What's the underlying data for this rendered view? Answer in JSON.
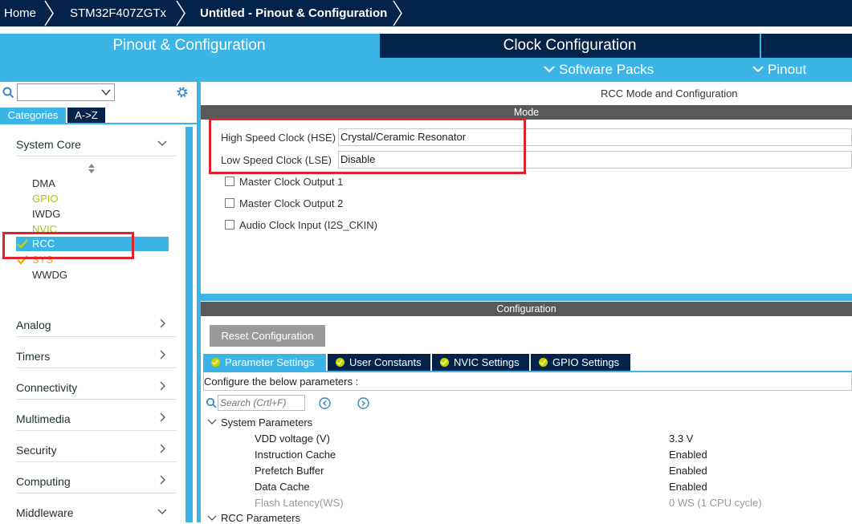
{
  "breadcrumb": {
    "home": "Home",
    "device": "STM32F407ZGTx",
    "project": "Untitled - Pinout & Configuration"
  },
  "main_tabs": {
    "pinout": "Pinout & Configuration",
    "clock": "Clock Configuration"
  },
  "sub_tabs": {
    "software_packs": "Software Packs",
    "pinout": "Pinout"
  },
  "sidebar": {
    "search_value": "",
    "view_tabs": [
      "Categories",
      "A->Z"
    ],
    "categories": {
      "system_core": "System Core",
      "analog": "Analog",
      "timers": "Timers",
      "connectivity": "Connectivity",
      "multimedia": "Multimedia",
      "security": "Security",
      "computing": "Computing",
      "middleware": "Middleware"
    },
    "peripherals": {
      "dma": "DMA",
      "gpio": "GPIO",
      "iwdg": "IWDG",
      "nvic": "NVIC",
      "rcc": "RCC",
      "sys": "SYS",
      "wwdg": "WWDG"
    }
  },
  "panel": {
    "title": "RCC Mode and Configuration",
    "mode_header": "Mode",
    "hse_label": "High Speed Clock (HSE)",
    "hse_value": "Crystal/Ceramic Resonator",
    "lse_label": "Low Speed Clock (LSE)",
    "lse_value": "Disable",
    "mco1": "Master Clock Output 1",
    "mco2": "Master Clock Output 2",
    "audio": "Audio Clock Input (I2S_CKIN)",
    "config_header": "Configuration",
    "reset_button": "Reset Configuration",
    "config_tabs": {
      "param": "Parameter Settings",
      "user": "User Constants",
      "nvic": "NVIC Settings",
      "gpio": "GPIO Settings"
    },
    "configure_text": "Configure the below parameters :",
    "search_placeholder": "Search (Crtl+F)",
    "system_params_header": "System Parameters",
    "rcc_params_header": "RCC Parameters",
    "params": {
      "vdd": {
        "name": "VDD voltage (V)",
        "value": "3.3 V"
      },
      "icache": {
        "name": "Instruction Cache",
        "value": "Enabled"
      },
      "prefetch": {
        "name": "Prefetch Buffer",
        "value": "Enabled"
      },
      "dcache": {
        "name": "Data Cache",
        "value": "Enabled"
      },
      "flash": {
        "name": "Flash Latency(WS)",
        "value": "0 WS (1 CPU cycle)"
      }
    }
  },
  "colors": {
    "navy": "#03234b",
    "accent": "#3cb4e6",
    "ok_green": "#c8d400",
    "warning_orange": "#f2a900",
    "highlight_red": "#e0232f"
  }
}
